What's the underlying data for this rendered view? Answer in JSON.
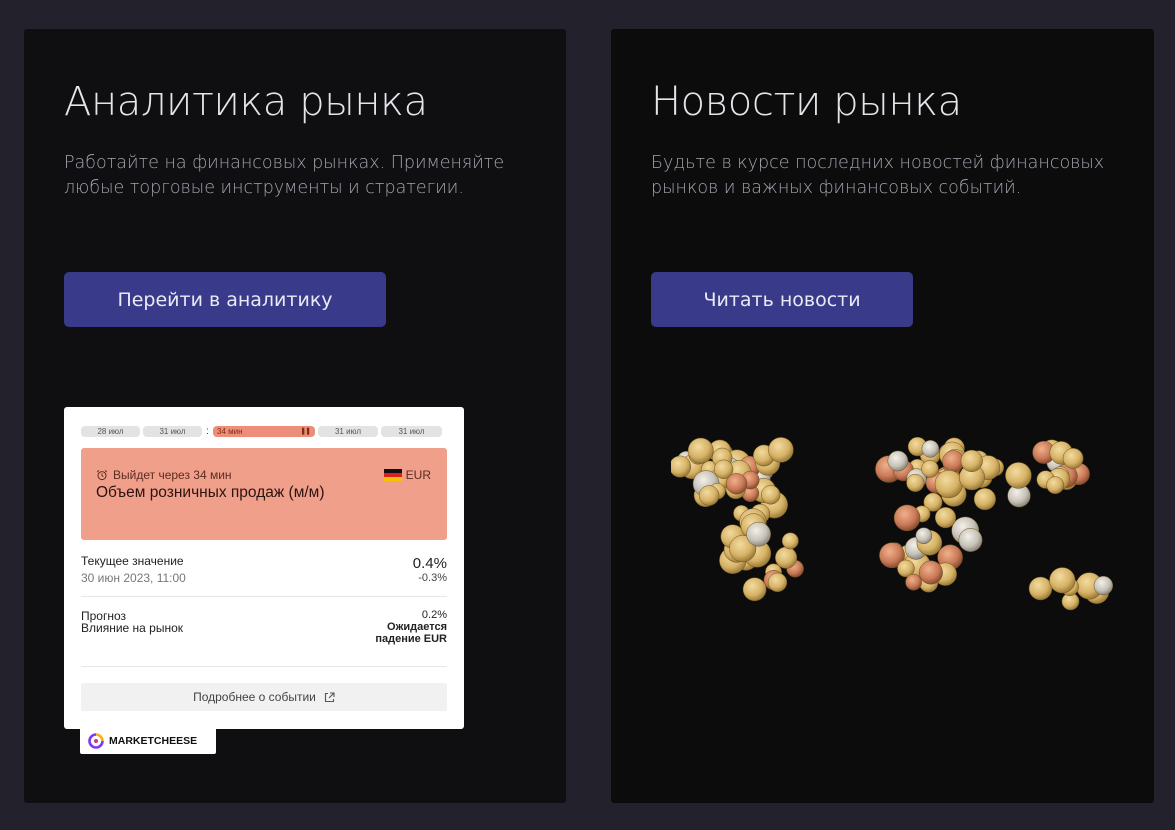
{
  "analytics": {
    "title": "Аналитика рынка",
    "description": "Работайте на финансовых рынках. Применяйте любые торговые инструменты и стратегии.",
    "button": "Перейти в аналитику"
  },
  "news": {
    "title": "Новости рынка",
    "description": "Будьте в курсе последних новостей финансовых рынков и важных финансовых событий.",
    "button": "Читать новости"
  },
  "widget": {
    "timeline": [
      "28 июл",
      "31 июл",
      "34 мин",
      "31 июл",
      "31 июл"
    ],
    "timeline_sep": ":",
    "event_status": "Выйдет через 34 мин",
    "currency": "EUR",
    "event_name": "Объем розничных продаж (м/м)",
    "current_label": "Текущее значение",
    "current_date": "30 июн 2023, 11:00",
    "current_value": "0.4%",
    "current_change": "-0.3%",
    "forecast_label": "Прогноз",
    "forecast_value": "0.2%",
    "impact_label": "Влияние на рынок",
    "impact_line1": "Ожидается",
    "impact_line2": "падение EUR",
    "more_button": "Подробнее о событии",
    "brand": "MARKETCHEESE"
  },
  "colors": {
    "page_bg": "#22212c",
    "card_bg": "#0f0e11",
    "button": "#3a3a8a",
    "event_highlight": "#f09f8a"
  },
  "icons": [
    "alarm-clock-icon",
    "germany-flag-icon",
    "external-link-icon",
    "marketcheese-logo-icon",
    "pause-icon"
  ]
}
